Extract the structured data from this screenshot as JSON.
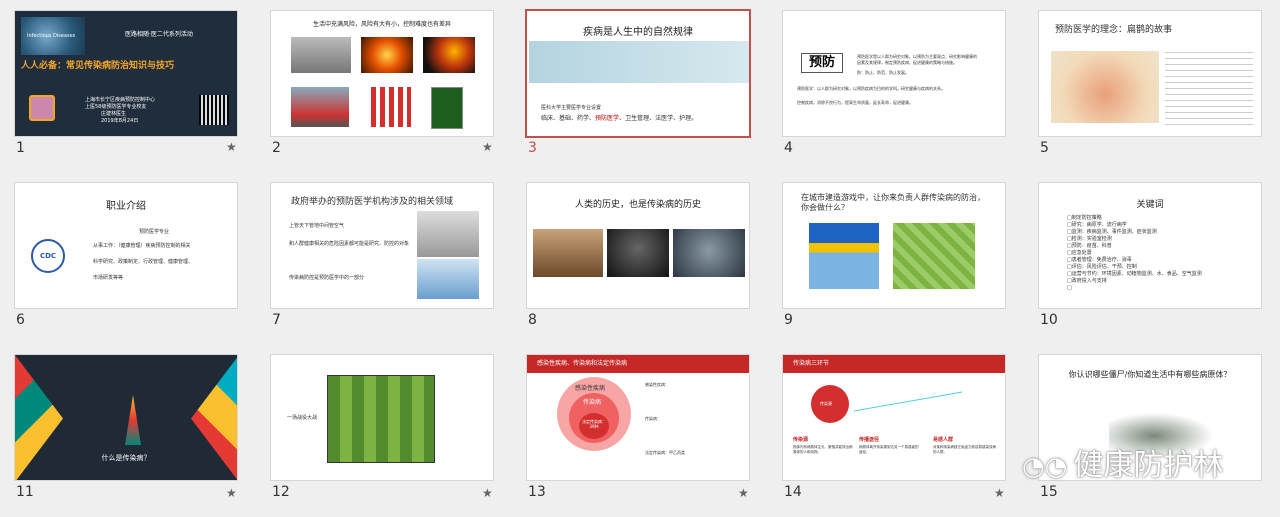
{
  "slides": [
    {
      "num": "1",
      "star": true,
      "org": "Infectious Diseases",
      "activity": "医路相随·医二代系列活动",
      "title": "人人必备：常见传染病防治知识与技巧",
      "center": "上海市长宁区疾病预防控制中心",
      "school": "上医58级预防医学专业校友",
      "speaker": "庄建林医生",
      "date": "2019年8月24日"
    },
    {
      "num": "2",
      "star": true,
      "title": "生活中充满风险，风险有大有小，控制难度也有差异"
    },
    {
      "num": "3",
      "star": false,
      "title": "疾病是人生中的自然规律",
      "sub": "医科大学主要医学专业设置",
      "fields": [
        "临床、",
        "基础、",
        "药学、",
        "预防医学、",
        "卫生管理、",
        "法医学、",
        "护理。"
      ]
    },
    {
      "num": "4",
      "star": false,
      "keyword": "预防",
      "lines": [
        "预防医学是以人群为研究对象，以预防为主要观点，研究影响健康的",
        "因素及其规律，制定预防疾病、促进健康的策略与措施。",
        "防：防止、防范、防止发展。",
        "预防医学：以人群为研究对象，以预防疾病为目的的学科。研究健康与疾病的关系。",
        "控制疾病，消除不良行为，提高生命质量，延长寿命，促进健康。"
      ]
    },
    {
      "num": "5",
      "star": false,
      "title": "预防医学的理念：扁鹊的故事"
    },
    {
      "num": "6",
      "star": false,
      "title": "职业介绍",
      "major": "预防医学专业",
      "lines": [
        "从事工作：（健康管理）疾病预防控制的相关",
        "科学研究、政策制定、行政管理、健康管理、",
        "市场研发等等"
      ]
    },
    {
      "num": "7",
      "star": false,
      "title": "政府举办的预防医学机构涉及的相关领域",
      "bullets": [
        "上管天下管地中间管空气",
        "和人群健康相关的危险因素都可能是研究、防控的对象",
        "传染病防控是预防医学中的一部分"
      ]
    },
    {
      "num": "8",
      "star": false,
      "title": "人类的历史，也是传染病的历史"
    },
    {
      "num": "9",
      "star": false,
      "title": "在城市建造游戏中，让你来负责人群传染病的防治，你会做什么？"
    },
    {
      "num": "10",
      "star": false,
      "title": "关键词",
      "items": [
        "□制定防控策略",
        "□研究：病原学、流行病学",
        "□监测：疾病监测、事件监测、症状监测",
        "□检测：实验室检测",
        "□预防：疫苗、科普",
        "□应急处置",
        "□患者管理：免费治疗、消毒",
        "□评估：风险评估、干预、控制",
        "□运营与节约：环境因素、动植物监测、水、食品、空气监测",
        "□政府投入与支持",
        "□"
      ]
    },
    {
      "num": "11",
      "star": true,
      "title": "什么是传染病？"
    },
    {
      "num": "12",
      "star": true,
      "caption": "一场战役大战"
    },
    {
      "num": "13",
      "star": true,
      "header": "感染性疾病、传染病和法定传染病",
      "outer": "感染性疾病",
      "middle": "传染病",
      "inner": "法定传染病：39种",
      "notes": [
        "感染性疾病：",
        "传染病：",
        "法定传染病：甲乙丙类"
      ]
    },
    {
      "num": "14",
      "star": true,
      "header": "传染病三环节",
      "center": "传染源",
      "cols": [
        {
          "h": "传染源",
          "t": "指体内有病原体生长、繁殖并能排出病原体的人和动物。"
        },
        {
          "h": "传播途径",
          "t": "病原体离开传染源到达另一个易感者的途径。"
        },
        {
          "h": "易感人群",
          "t": "对某种传染病缺乏免疫力而容易感染该病的人群。"
        }
      ]
    },
    {
      "num": "15",
      "star": false,
      "title": "你认识哪些僵尸/你知道生活中有哪些病原体？"
    }
  ],
  "watermark": {
    "icon": "wechat-icon",
    "text": "健康防护林"
  },
  "colors": {
    "selected": "#c0504d",
    "accent_red": "#c00000",
    "dark_navy": "#1f2d3d"
  }
}
